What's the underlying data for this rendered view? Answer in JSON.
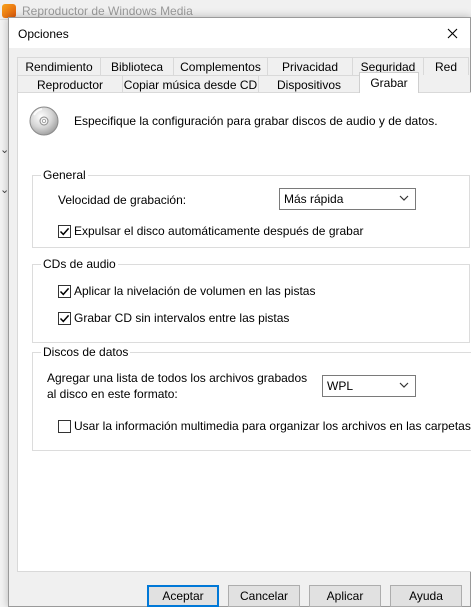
{
  "background_window": {
    "title": "Reproductor de Windows Media"
  },
  "dialog": {
    "title": "Opciones"
  },
  "tabs": {
    "row1": [
      "Rendimiento",
      "Biblioteca",
      "Complementos",
      "Privacidad",
      "Seguridad",
      "Red"
    ],
    "row2": [
      "Reproductor",
      "Copiar música desde CD",
      "Dispositivos",
      "Grabar"
    ],
    "active": "Grabar"
  },
  "panel": {
    "description": "Especifique la configuración para grabar discos de audio y de datos.",
    "general": {
      "title": "General",
      "speed_label": "Velocidad de grabación:",
      "speed_value": "Más rápida",
      "eject_label": "Expulsar el disco automáticamente después de grabar",
      "eject_checked": true
    },
    "audio": {
      "title": "CDs de audio",
      "leveling_label": "Aplicar la nivelación de volumen en las pistas",
      "leveling_checked": true,
      "gapless_label": "Grabar CD sin intervalos entre las pistas",
      "gapless_checked": true
    },
    "data": {
      "title": "Discos de datos",
      "list_label_line1": "Agregar una lista de todos los archivos grabados",
      "list_label_line2": "al disco en este formato:",
      "format_value": "WPL",
      "media_info_label": "Usar la información multimedia para organizar los archivos en las carpetas",
      "media_info_checked": false
    }
  },
  "buttons": {
    "ok": "Aceptar",
    "cancel": "Cancelar",
    "apply": "Aplicar",
    "help": "Ayuda"
  },
  "icons": {
    "disc": "cd-icon",
    "close": "close-icon",
    "check": "checkmark-icon",
    "dropdown": "chevron-down-icon"
  }
}
